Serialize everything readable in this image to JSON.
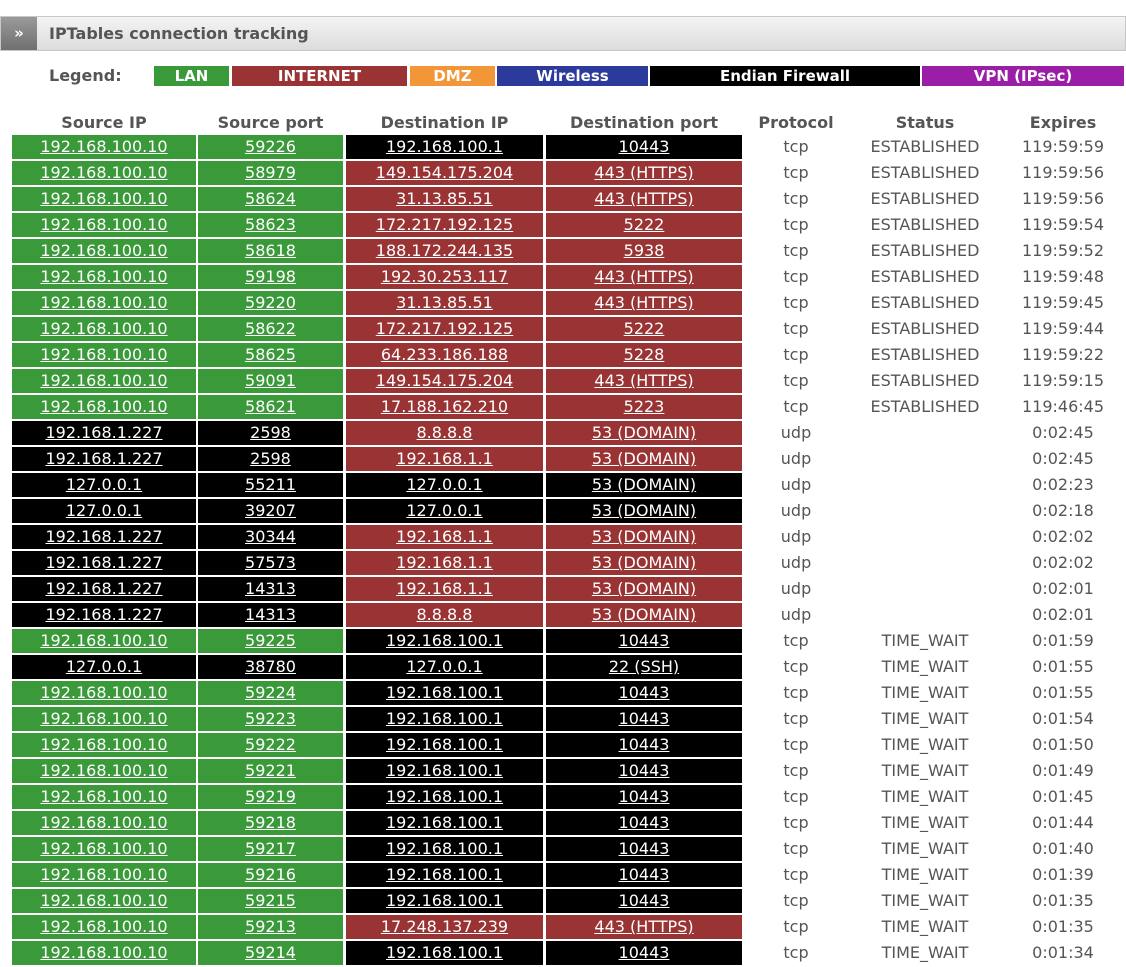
{
  "header": {
    "toggle": "»",
    "title": "IPTables connection tracking"
  },
  "colors": {
    "LAN": "#3a9a3a",
    "INTERNET": "#9a3434",
    "DMZ": "#f39637",
    "Wireless": "#2c3a9c",
    "FIREWALL": "#000000",
    "VPN": "#9b1fa6"
  },
  "legend": {
    "label": "Legend:",
    "items": [
      {
        "label": "LAN",
        "zone": "LAN"
      },
      {
        "label": "INTERNET",
        "zone": "INTERNET"
      },
      {
        "label": "DMZ",
        "zone": "DMZ"
      },
      {
        "label": "Wireless",
        "zone": "Wireless"
      },
      {
        "label": "Endian Firewall",
        "zone": "FIREWALL"
      },
      {
        "label": "VPN (IPsec)",
        "zone": "VPN"
      }
    ]
  },
  "columns": [
    "Source IP",
    "Source port",
    "Destination IP",
    "Destination port",
    "Protocol",
    "Status",
    "Expires"
  ],
  "rows": [
    {
      "src": "192.168.100.10",
      "sport": "59226",
      "dst": "192.168.100.1",
      "dport": "10443",
      "proto": "tcp",
      "status": "ESTABLISHED",
      "expires": "119:59:59",
      "srcZone": "LAN",
      "dstZone": "FIREWALL"
    },
    {
      "src": "192.168.100.10",
      "sport": "58979",
      "dst": "149.154.175.204",
      "dport": "443 (HTTPS)",
      "proto": "tcp",
      "status": "ESTABLISHED",
      "expires": "119:59:56",
      "srcZone": "LAN",
      "dstZone": "INTERNET"
    },
    {
      "src": "192.168.100.10",
      "sport": "58624",
      "dst": "31.13.85.51",
      "dport": "443 (HTTPS)",
      "proto": "tcp",
      "status": "ESTABLISHED",
      "expires": "119:59:56",
      "srcZone": "LAN",
      "dstZone": "INTERNET"
    },
    {
      "src": "192.168.100.10",
      "sport": "58623",
      "dst": "172.217.192.125",
      "dport": "5222",
      "proto": "tcp",
      "status": "ESTABLISHED",
      "expires": "119:59:54",
      "srcZone": "LAN",
      "dstZone": "INTERNET"
    },
    {
      "src": "192.168.100.10",
      "sport": "58618",
      "dst": "188.172.244.135",
      "dport": "5938",
      "proto": "tcp",
      "status": "ESTABLISHED",
      "expires": "119:59:52",
      "srcZone": "LAN",
      "dstZone": "INTERNET"
    },
    {
      "src": "192.168.100.10",
      "sport": "59198",
      "dst": "192.30.253.117",
      "dport": "443 (HTTPS)",
      "proto": "tcp",
      "status": "ESTABLISHED",
      "expires": "119:59:48",
      "srcZone": "LAN",
      "dstZone": "INTERNET"
    },
    {
      "src": "192.168.100.10",
      "sport": "59220",
      "dst": "31.13.85.51",
      "dport": "443 (HTTPS)",
      "proto": "tcp",
      "status": "ESTABLISHED",
      "expires": "119:59:45",
      "srcZone": "LAN",
      "dstZone": "INTERNET"
    },
    {
      "src": "192.168.100.10",
      "sport": "58622",
      "dst": "172.217.192.125",
      "dport": "5222",
      "proto": "tcp",
      "status": "ESTABLISHED",
      "expires": "119:59:44",
      "srcZone": "LAN",
      "dstZone": "INTERNET"
    },
    {
      "src": "192.168.100.10",
      "sport": "58625",
      "dst": "64.233.186.188",
      "dport": "5228",
      "proto": "tcp",
      "status": "ESTABLISHED",
      "expires": "119:59:22",
      "srcZone": "LAN",
      "dstZone": "INTERNET"
    },
    {
      "src": "192.168.100.10",
      "sport": "59091",
      "dst": "149.154.175.204",
      "dport": "443 (HTTPS)",
      "proto": "tcp",
      "status": "ESTABLISHED",
      "expires": "119:59:15",
      "srcZone": "LAN",
      "dstZone": "INTERNET"
    },
    {
      "src": "192.168.100.10",
      "sport": "58621",
      "dst": "17.188.162.210",
      "dport": "5223",
      "proto": "tcp",
      "status": "ESTABLISHED",
      "expires": "119:46:45",
      "srcZone": "LAN",
      "dstZone": "INTERNET"
    },
    {
      "src": "192.168.1.227",
      "sport": "2598",
      "dst": "8.8.8.8",
      "dport": "53 (DOMAIN)",
      "proto": "udp",
      "status": "",
      "expires": "0:02:45",
      "srcZone": "FIREWALL",
      "dstZone": "INTERNET"
    },
    {
      "src": "192.168.1.227",
      "sport": "2598",
      "dst": "192.168.1.1",
      "dport": "53 (DOMAIN)",
      "proto": "udp",
      "status": "",
      "expires": "0:02:45",
      "srcZone": "FIREWALL",
      "dstZone": "INTERNET"
    },
    {
      "src": "127.0.0.1",
      "sport": "55211",
      "dst": "127.0.0.1",
      "dport": "53 (DOMAIN)",
      "proto": "udp",
      "status": "",
      "expires": "0:02:23",
      "srcZone": "FIREWALL",
      "dstZone": "FIREWALL"
    },
    {
      "src": "127.0.0.1",
      "sport": "39207",
      "dst": "127.0.0.1",
      "dport": "53 (DOMAIN)",
      "proto": "udp",
      "status": "",
      "expires": "0:02:18",
      "srcZone": "FIREWALL",
      "dstZone": "FIREWALL"
    },
    {
      "src": "192.168.1.227",
      "sport": "30344",
      "dst": "192.168.1.1",
      "dport": "53 (DOMAIN)",
      "proto": "udp",
      "status": "",
      "expires": "0:02:02",
      "srcZone": "FIREWALL",
      "dstZone": "INTERNET"
    },
    {
      "src": "192.168.1.227",
      "sport": "57573",
      "dst": "192.168.1.1",
      "dport": "53 (DOMAIN)",
      "proto": "udp",
      "status": "",
      "expires": "0:02:02",
      "srcZone": "FIREWALL",
      "dstZone": "INTERNET"
    },
    {
      "src": "192.168.1.227",
      "sport": "14313",
      "dst": "192.168.1.1",
      "dport": "53 (DOMAIN)",
      "proto": "udp",
      "status": "",
      "expires": "0:02:01",
      "srcZone": "FIREWALL",
      "dstZone": "INTERNET"
    },
    {
      "src": "192.168.1.227",
      "sport": "14313",
      "dst": "8.8.8.8",
      "dport": "53 (DOMAIN)",
      "proto": "udp",
      "status": "",
      "expires": "0:02:01",
      "srcZone": "FIREWALL",
      "dstZone": "INTERNET"
    },
    {
      "src": "192.168.100.10",
      "sport": "59225",
      "dst": "192.168.100.1",
      "dport": "10443",
      "proto": "tcp",
      "status": "TIME_WAIT",
      "expires": "0:01:59",
      "srcZone": "LAN",
      "dstZone": "FIREWALL"
    },
    {
      "src": "127.0.0.1",
      "sport": "38780",
      "dst": "127.0.0.1",
      "dport": "22 (SSH)",
      "proto": "tcp",
      "status": "TIME_WAIT",
      "expires": "0:01:55",
      "srcZone": "FIREWALL",
      "dstZone": "FIREWALL"
    },
    {
      "src": "192.168.100.10",
      "sport": "59224",
      "dst": "192.168.100.1",
      "dport": "10443",
      "proto": "tcp",
      "status": "TIME_WAIT",
      "expires": "0:01:55",
      "srcZone": "LAN",
      "dstZone": "FIREWALL"
    },
    {
      "src": "192.168.100.10",
      "sport": "59223",
      "dst": "192.168.100.1",
      "dport": "10443",
      "proto": "tcp",
      "status": "TIME_WAIT",
      "expires": "0:01:54",
      "srcZone": "LAN",
      "dstZone": "FIREWALL"
    },
    {
      "src": "192.168.100.10",
      "sport": "59222",
      "dst": "192.168.100.1",
      "dport": "10443",
      "proto": "tcp",
      "status": "TIME_WAIT",
      "expires": "0:01:50",
      "srcZone": "LAN",
      "dstZone": "FIREWALL"
    },
    {
      "src": "192.168.100.10",
      "sport": "59221",
      "dst": "192.168.100.1",
      "dport": "10443",
      "proto": "tcp",
      "status": "TIME_WAIT",
      "expires": "0:01:49",
      "srcZone": "LAN",
      "dstZone": "FIREWALL"
    },
    {
      "src": "192.168.100.10",
      "sport": "59219",
      "dst": "192.168.100.1",
      "dport": "10443",
      "proto": "tcp",
      "status": "TIME_WAIT",
      "expires": "0:01:45",
      "srcZone": "LAN",
      "dstZone": "FIREWALL"
    },
    {
      "src": "192.168.100.10",
      "sport": "59218",
      "dst": "192.168.100.1",
      "dport": "10443",
      "proto": "tcp",
      "status": "TIME_WAIT",
      "expires": "0:01:44",
      "srcZone": "LAN",
      "dstZone": "FIREWALL"
    },
    {
      "src": "192.168.100.10",
      "sport": "59217",
      "dst": "192.168.100.1",
      "dport": "10443",
      "proto": "tcp",
      "status": "TIME_WAIT",
      "expires": "0:01:40",
      "srcZone": "LAN",
      "dstZone": "FIREWALL"
    },
    {
      "src": "192.168.100.10",
      "sport": "59216",
      "dst": "192.168.100.1",
      "dport": "10443",
      "proto": "tcp",
      "status": "TIME_WAIT",
      "expires": "0:01:39",
      "srcZone": "LAN",
      "dstZone": "FIREWALL"
    },
    {
      "src": "192.168.100.10",
      "sport": "59215",
      "dst": "192.168.100.1",
      "dport": "10443",
      "proto": "tcp",
      "status": "TIME_WAIT",
      "expires": "0:01:35",
      "srcZone": "LAN",
      "dstZone": "FIREWALL"
    },
    {
      "src": "192.168.100.10",
      "sport": "59213",
      "dst": "17.248.137.239",
      "dport": "443 (HTTPS)",
      "proto": "tcp",
      "status": "TIME_WAIT",
      "expires": "0:01:35",
      "srcZone": "LAN",
      "dstZone": "INTERNET"
    },
    {
      "src": "192.168.100.10",
      "sport": "59214",
      "dst": "192.168.100.1",
      "dport": "10443",
      "proto": "tcp",
      "status": "TIME_WAIT",
      "expires": "0:01:34",
      "srcZone": "LAN",
      "dstZone": "FIREWALL"
    }
  ]
}
